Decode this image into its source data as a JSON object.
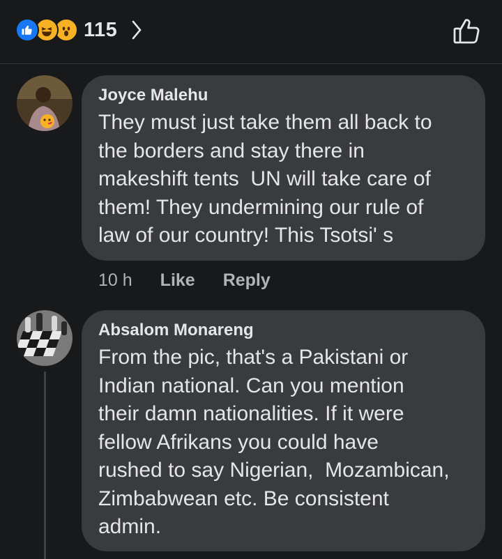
{
  "reactions": {
    "count": "115",
    "types": [
      {
        "name": "like",
        "color": "#1877f2"
      },
      {
        "name": "haha",
        "color": "#f7b125"
      },
      {
        "name": "wow",
        "color": "#f7b125"
      }
    ]
  },
  "comments": [
    {
      "author": "Joyce Malehu",
      "text": "They must just take them all back to\nthe borders and stay there in\nmakeshift tents  UN will take care of\nthem! They undermining our rule of\nlaw of our country! This Tsotsi' s",
      "time": "10 h",
      "like_label": "Like",
      "reply_label": "Reply"
    },
    {
      "author": "Absalom Monareng",
      "text": "From the pic, that's a Pakistani or\nIndian national. Can you mention\ntheir damn nationalities. If it were\nfellow Afrikans you could have\nrushed to say Nigerian,  Mozambican,\nZimbabwean etc. Be consistent\nadmin."
    }
  ],
  "colors": {
    "background": "#18191a",
    "bubble": "#3a3b3c",
    "text": "#e4e6eb",
    "secondary_text": "#b0b3b8"
  }
}
